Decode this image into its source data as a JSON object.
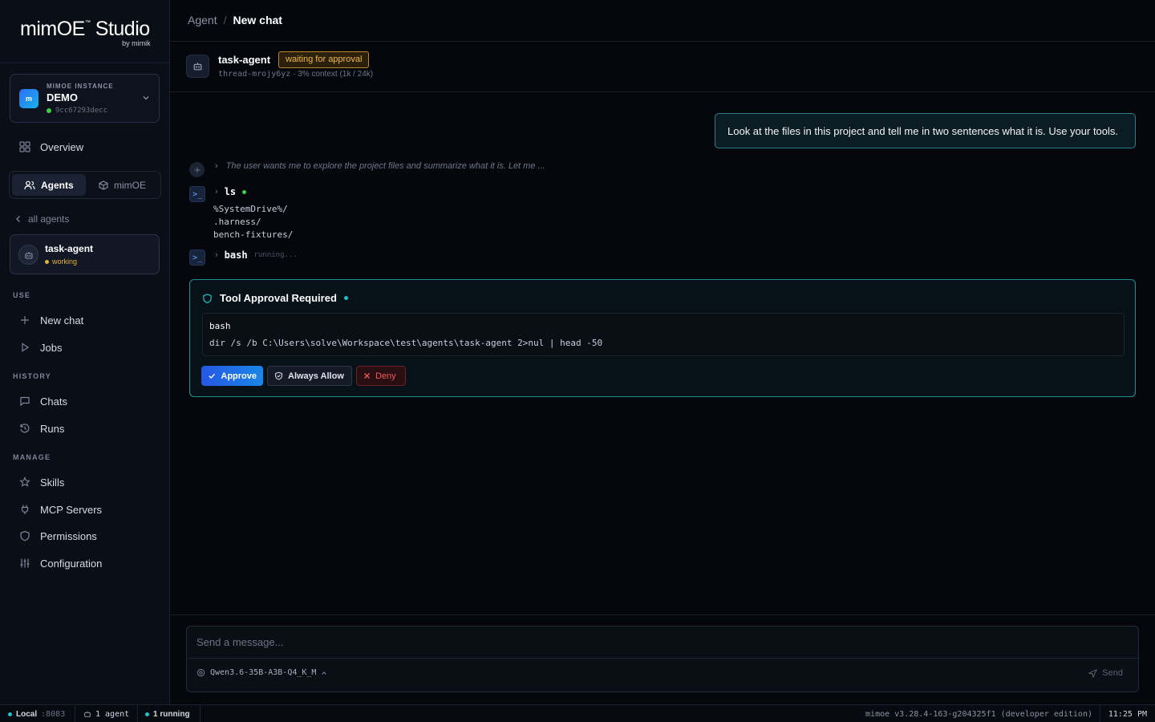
{
  "brand": {
    "name": "mimOE",
    "tm": "™",
    "suffix": "Studio",
    "by": "by mimik"
  },
  "instance": {
    "label": "MIMOE INSTANCE",
    "name": "DEMO",
    "id": "9cc67293decc",
    "logo_text": "m"
  },
  "nav": {
    "overview": "Overview",
    "tabs": {
      "agents": "Agents",
      "mimoe": "mimOE"
    },
    "back": "all agents",
    "agent": {
      "name": "task-agent",
      "status": "working"
    },
    "sections": {
      "use": {
        "title": "USE",
        "items": [
          "New chat",
          "Jobs"
        ]
      },
      "history": {
        "title": "HISTORY",
        "items": [
          "Chats",
          "Runs"
        ]
      },
      "manage": {
        "title": "MANAGE",
        "items": [
          "Skills",
          "MCP Servers",
          "Permissions",
          "Configuration"
        ]
      }
    }
  },
  "breadcrumb": {
    "parent": "Agent",
    "sep": "/",
    "current": "New chat"
  },
  "thread": {
    "agent": "task-agent",
    "badge": "waiting for approval",
    "id": "thread-mrojy6yz",
    "context": "· 3% context (1k / 24k)"
  },
  "messages": {
    "user": "Look at the files in this project and tell me in two sentences what it is. Use your tools.",
    "thinking": "The user wants me to explore the project files and summarize what it is. Let me ...",
    "tool1": {
      "name": "ls",
      "output": [
        "%SystemDrive%/",
        ".harness/",
        "bench-fixtures/"
      ]
    },
    "tool2": {
      "name": "bash",
      "status": "running..."
    }
  },
  "approval": {
    "title": "Tool Approval Required",
    "tool": "bash",
    "command": "dir /s /b C:\\Users\\solve\\Workspace\\test\\agents\\task-agent 2>nul | head -50",
    "approve": "Approve",
    "always": "Always Allow",
    "deny": "Deny"
  },
  "composer": {
    "placeholder": "Send a message...",
    "model": "Qwen3.6-35B-A3B-Q4_K_M",
    "send": "Send"
  },
  "statusbar": {
    "local": "Local",
    "port": ":8083",
    "agents": "1 agent",
    "running": "1 running",
    "version": "mimoe v3.28.4-163-g204325f1 (developer edition)",
    "time": "11:25 PM"
  },
  "colors": {
    "accent": "#1f8f95",
    "approve": "#2557e6",
    "warning": "#f1b73b",
    "deny": "#ef5a5a",
    "ok": "#3ecf4a",
    "live": "#22c1c3"
  }
}
